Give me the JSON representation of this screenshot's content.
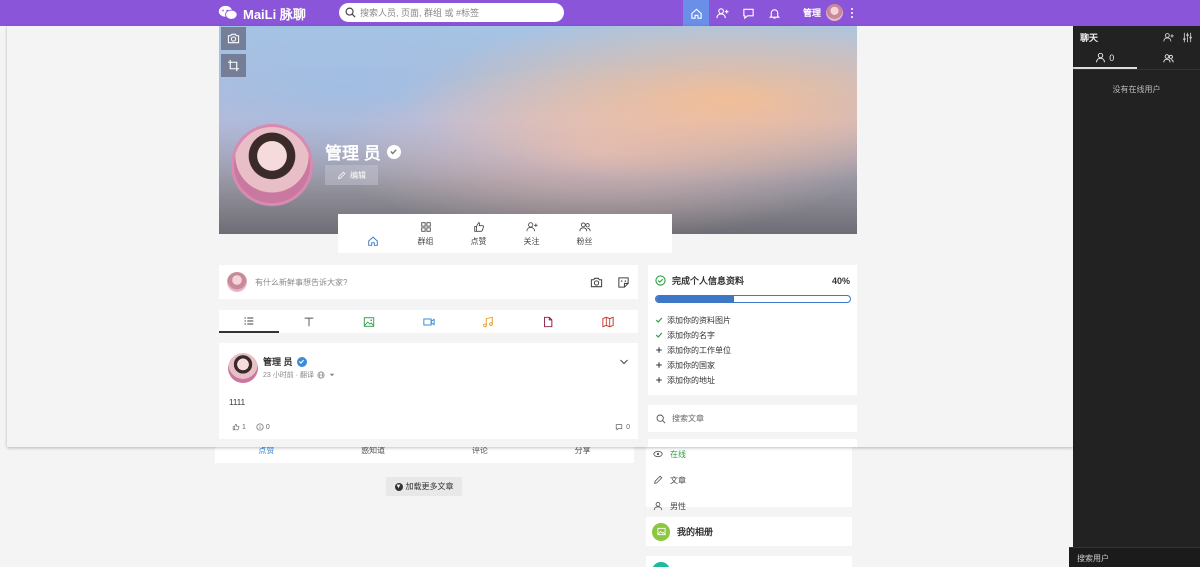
{
  "topbar": {
    "logo_text": "MaiLi 脉聊",
    "search_placeholder": "搜索人员, 页面, 群组 或 #标签",
    "user_name": "管理",
    "icons": [
      "home-icon",
      "add-user-icon",
      "messages-icon",
      "notifications-icon",
      "more-icon"
    ]
  },
  "chat": {
    "title": "聊天",
    "online_count": "0",
    "empty_text": "没有在线用户",
    "search_label": "搜索用户"
  },
  "profile": {
    "name": "管理 员",
    "edit_label": "编辑",
    "nav": [
      {
        "label": "",
        "icon": "home-icon"
      },
      {
        "label": "群组",
        "icon": "groups-icon"
      },
      {
        "label": "点赞",
        "icon": "thumbs-up-icon"
      },
      {
        "label": "关注",
        "icon": "follow-icon"
      },
      {
        "label": "粉丝",
        "icon": "followers-icon"
      }
    ]
  },
  "composer": {
    "placeholder": "有什么新鲜事想告诉大家?"
  },
  "post": {
    "author": "管理 员",
    "time": "23 小时前 · 翻译",
    "text": "1111",
    "likes": "1",
    "wonders": "0",
    "comments": "0"
  },
  "actions": {
    "like": "点赞",
    "wonder": "惑知道",
    "comment": "评论",
    "share": "分享"
  },
  "load_more": "加载更多文章",
  "completion": {
    "title": "完成个人信息资料",
    "percent_label": "40%",
    "percent": 40,
    "items": [
      {
        "label": "添加你的资料图片",
        "done": true
      },
      {
        "label": "添加你的名字",
        "done": true
      },
      {
        "label": "添加你的工作单位",
        "done": false
      },
      {
        "label": "添加你的国家",
        "done": false
      },
      {
        "label": "添加你的地址",
        "done": false
      }
    ]
  },
  "article_search_placeholder": "搜索文章",
  "about": {
    "online": "在线",
    "articles": "文章",
    "gender": "男性"
  },
  "album_title": "我的相册",
  "colors": {
    "topbar": "#8b55d9",
    "active_tab": "#6a8fe8",
    "progress": "#3d78c6",
    "check": "#2e9e44"
  }
}
